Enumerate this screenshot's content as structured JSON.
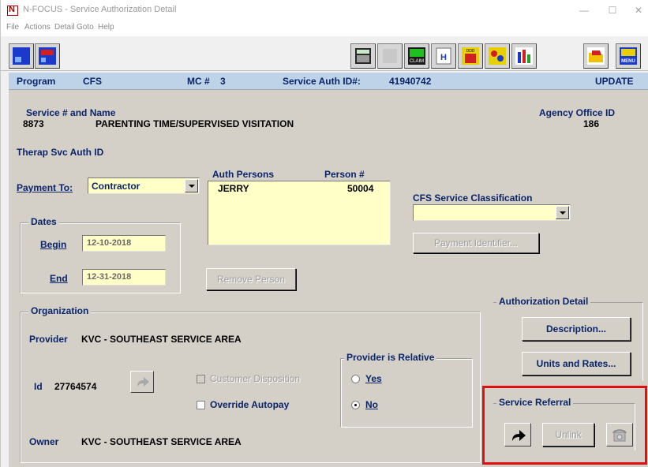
{
  "window": {
    "title": "N-FOCUS - Service Authorization Detail",
    "minimize": "—",
    "maximize": "☐",
    "close": "✕"
  },
  "menu": [
    "File",
    "Actions",
    "Detail",
    "Goto",
    "Help"
  ],
  "toolbar": {
    "left_buttons": [
      "window-icon",
      "window-red-icon"
    ],
    "right_buttons": [
      "calculator-icon",
      "blank-icon",
      "claim-icon",
      "history-icon",
      "ddd-icon",
      "people-icon",
      "chart-icon",
      "folder-icon",
      "menu-icon"
    ],
    "claim_text": "CLAIM",
    "history_text": "H",
    "ddd_text": "DDD",
    "menu_text": "MENU"
  },
  "header": {
    "program_label": "Program",
    "program_value": "CFS",
    "mc_label": "MC #",
    "mc_value": "3",
    "sa_label": "Service Auth ID#:",
    "sa_value": "41940742",
    "mode": "UPDATE"
  },
  "service": {
    "label": "Service # and Name",
    "number": "8873",
    "name": "PARENTING TIME/SUPERVISED VISITATION",
    "agency_label": "Agency Office ID",
    "agency_value": "186",
    "therap_label": "Therap Svc Auth ID"
  },
  "payment": {
    "label": "Payment To:",
    "value": "Contractor"
  },
  "auth_persons": {
    "col1": "Auth Persons",
    "col2": "Person #",
    "rows": [
      {
        "name": "JERRY",
        "number": "50004"
      }
    ],
    "remove_button": "Remove Person"
  },
  "dates": {
    "title": "Dates",
    "begin_label": "Begin",
    "begin_value": "12-10-2018",
    "end_label": "End",
    "end_value": "12-31-2018"
  },
  "cfs": {
    "label": "CFS Service Classification",
    "value": "",
    "payment_identifier_button": "Payment Identifier..."
  },
  "organization": {
    "title": "Organization",
    "provider_label": "Provider",
    "provider_value": "KVC - SOUTHEAST SERVICE AREA",
    "id_label": "Id",
    "id_value": "27764574",
    "customer_disposition": "Customer Disposition",
    "override_autopay": "Override Autopay",
    "owner_label": "Owner",
    "owner_value": "KVC - SOUTHEAST SERVICE AREA"
  },
  "provider_relative": {
    "title": "Provider is Relative",
    "yes": "Yes",
    "no": "No",
    "selected": "No"
  },
  "auth_detail": {
    "title": "Authorization Detail",
    "description_button": "Description...",
    "units_button": "Units and Rates..."
  },
  "service_referral": {
    "title": "Service Referral",
    "unlink_button": "Unlink"
  },
  "colors": {
    "accent": "#0a246a",
    "field_bg": "#ffffc8",
    "highlight": "#e01010"
  }
}
